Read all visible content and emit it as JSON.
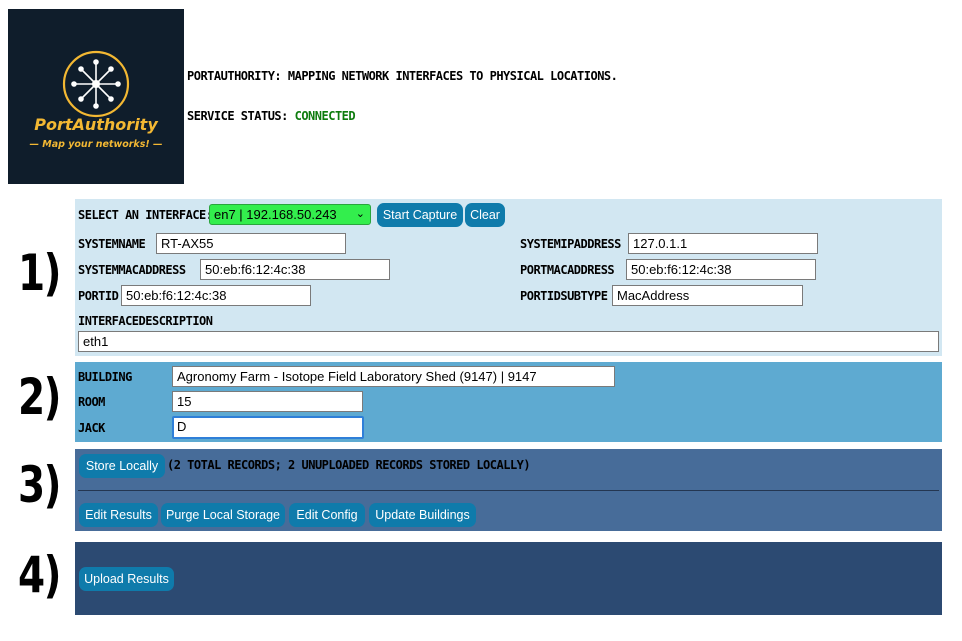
{
  "logo": {
    "title": "PortAuthority",
    "tagline": "— Map your networks! —",
    "icon": "network-hub-icon"
  },
  "header": {
    "description": "PORTAUTHORITY: MAPPING NETWORK INTERFACES TO PHYSICAL LOCATIONS.",
    "status_label": "SERVICE STATUS:",
    "status_value": "CONNECTED"
  },
  "steps": [
    "1)",
    "2)",
    "3)",
    "4)"
  ],
  "capture": {
    "interface_label": "SELECT AN INTERFACE:",
    "interface_selected": "en7 | 192.168.50.243",
    "start_label": "Start Capture",
    "clear_label": "Clear",
    "fields": {
      "systemname": {
        "label": "SYSTEMNAME",
        "value": "RT-AX55"
      },
      "systemipaddress": {
        "label": "SYSTEMIPADDRESS",
        "value": "127.0.1.1"
      },
      "systemmacaddress": {
        "label": "SYSTEMMACADDRESS",
        "value": "50:eb:f6:12:4c:38"
      },
      "portmacaddress": {
        "label": "PORTMACADDRESS",
        "value": "50:eb:f6:12:4c:38"
      },
      "portid": {
        "label": "PORTID",
        "value": "50:eb:f6:12:4c:38"
      },
      "portidsubtype": {
        "label": "PORTIDSUBTYPE",
        "value": "MacAddress"
      },
      "interfacedescription": {
        "label": "INTERFACEDESCRIPTION",
        "value": "eth1"
      }
    }
  },
  "location": {
    "building_label": "BUILDING",
    "building_value": "Agronomy Farm - Isotope Field Laboratory Shed (9147) | 9147",
    "room_label": "ROOM",
    "room_value": "15",
    "jack_label": "JACK",
    "jack_value": "D"
  },
  "storage": {
    "store_label": "Store Locally",
    "records_text": "(2 TOTAL RECORDS; 2 UNUPLOADED RECORDS STORED LOCALLY)",
    "edit_results_label": "Edit Results",
    "purge_label": "Purge Local Storage",
    "edit_config_label": "Edit Config",
    "update_buildings_label": "Update Buildings"
  },
  "upload": {
    "upload_label": "Upload Results"
  },
  "colors": {
    "logo_bg": "#0f1d2b",
    "logo_accent": "#f3b833",
    "panel1": "#d2e7f2",
    "panel2": "#5eaad1",
    "panel3": "#476c99",
    "panel4": "#2c4a72",
    "button": "#0f7bab",
    "select_bg": "#33ee4d",
    "status_ok": "#0e7c0e"
  }
}
